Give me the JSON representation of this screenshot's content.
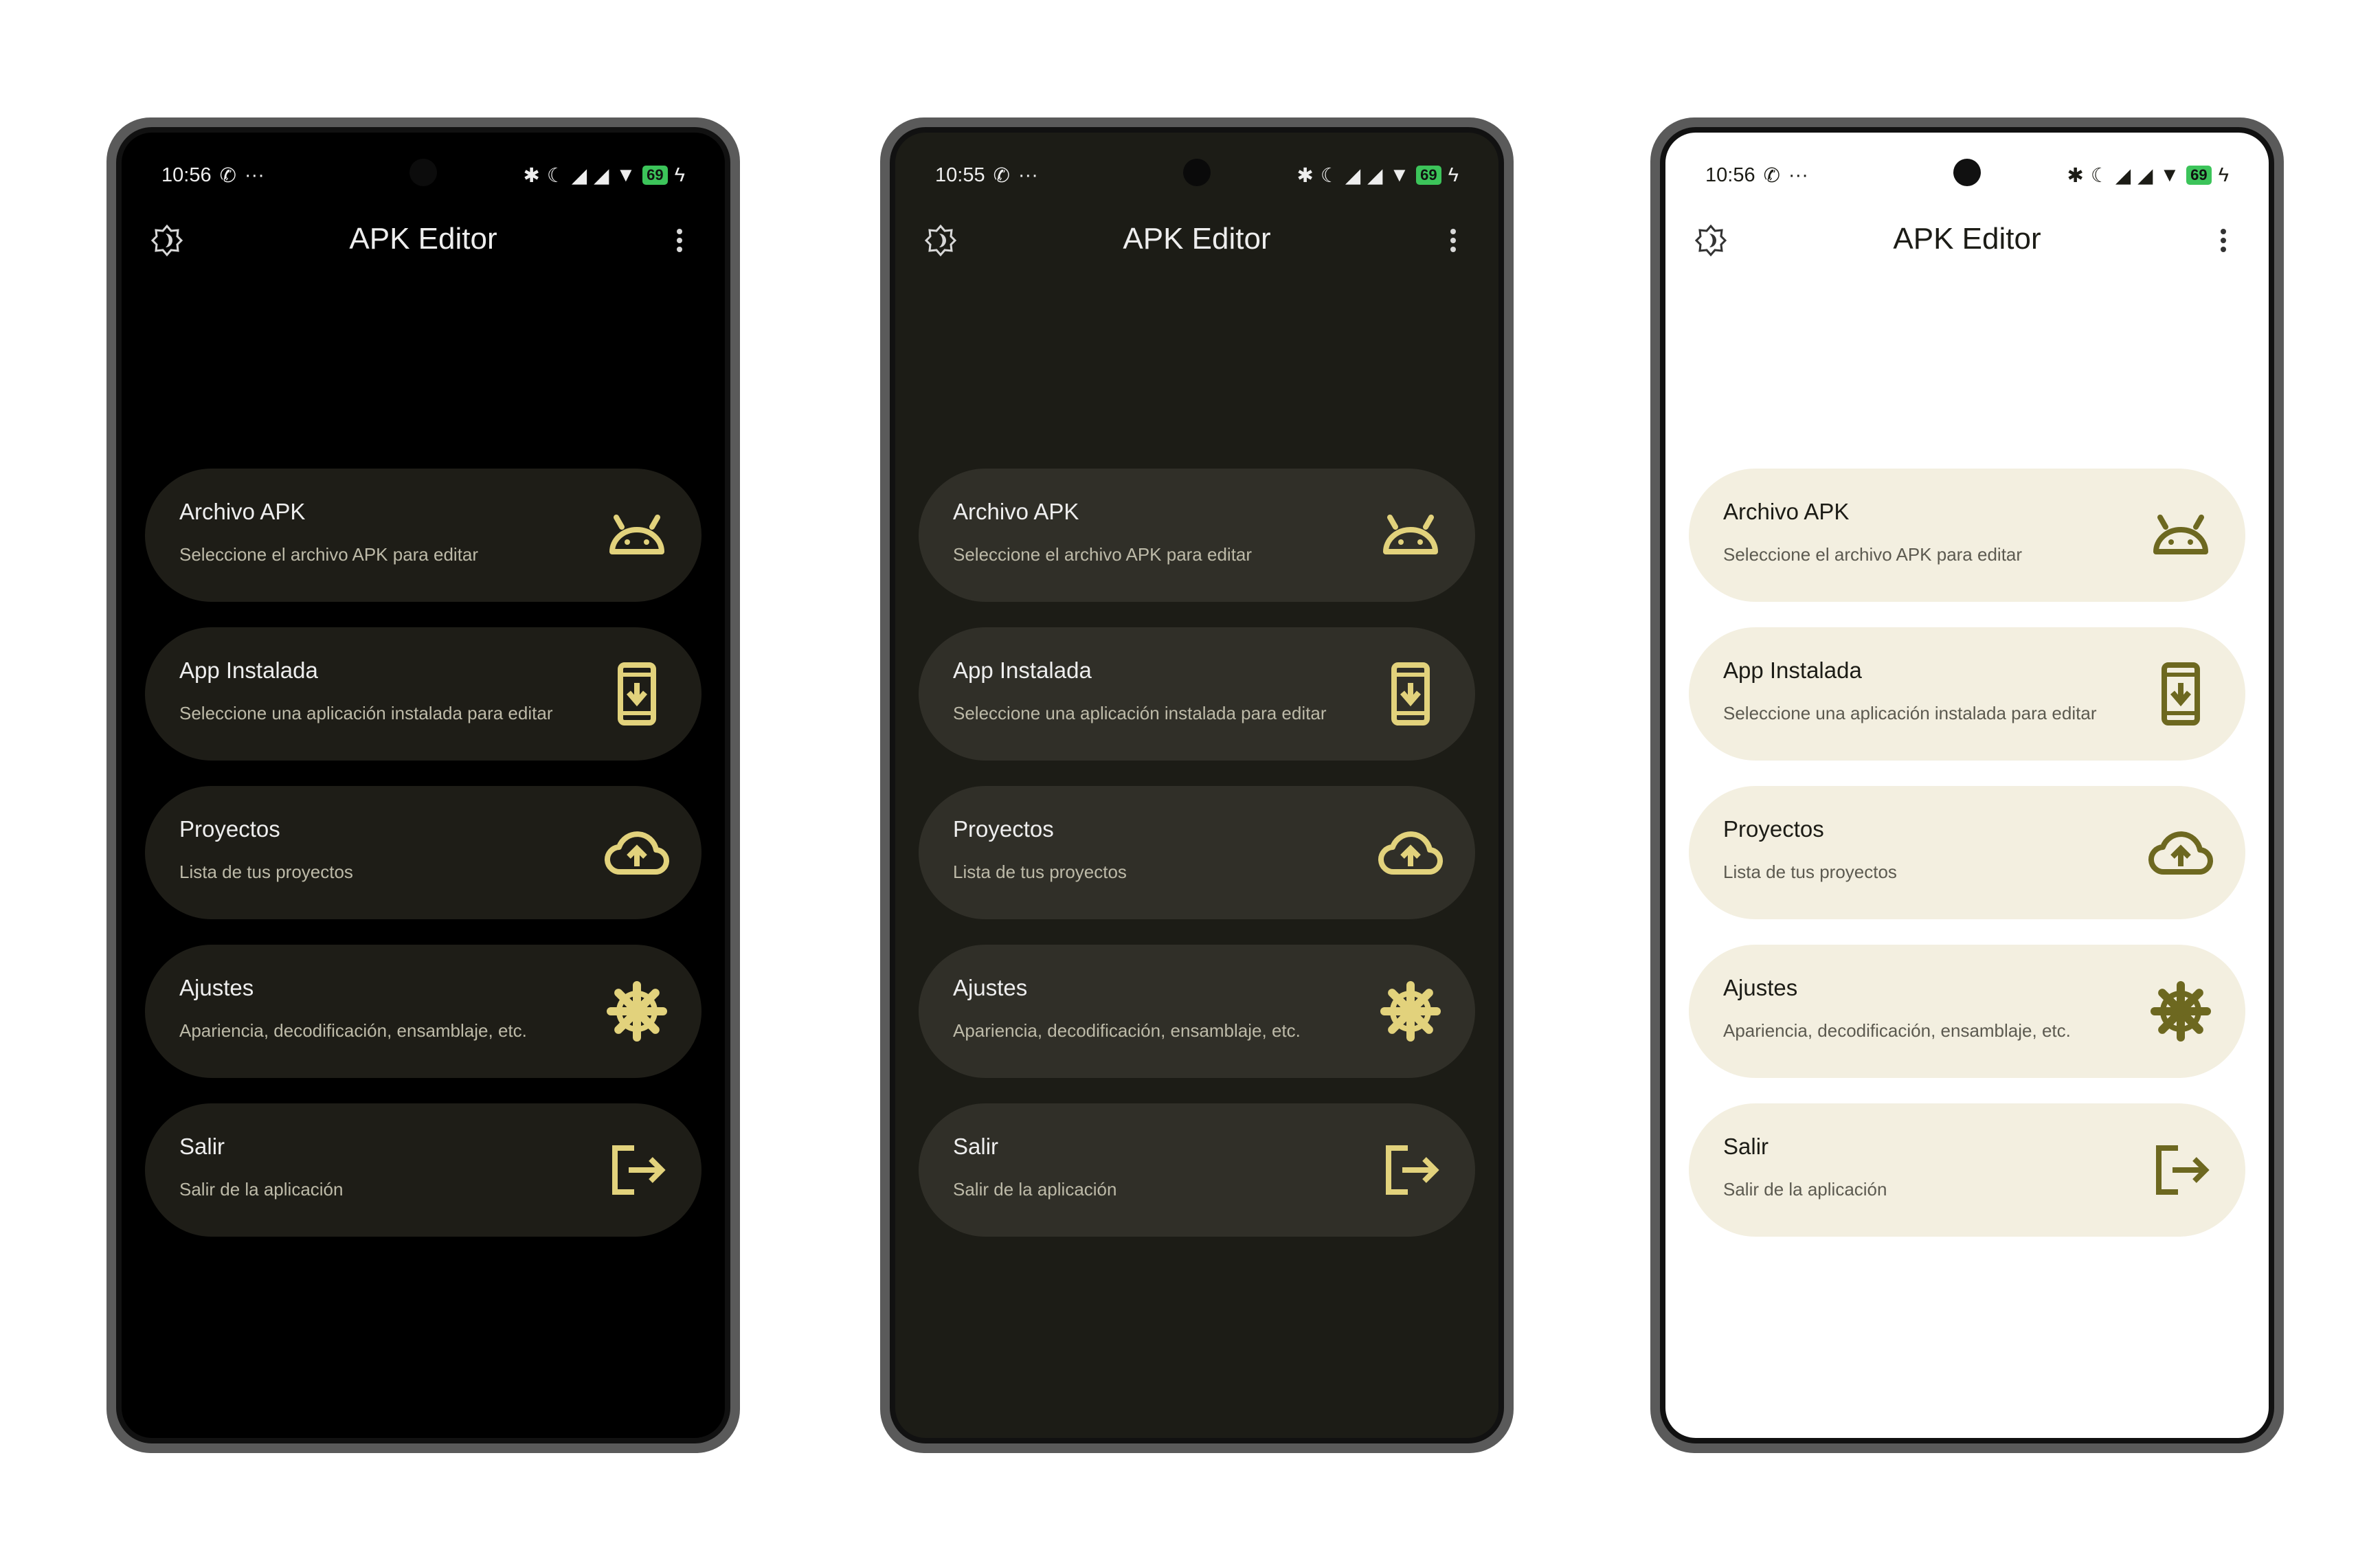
{
  "app": {
    "title": "APK Editor",
    "status_more": "···",
    "battery": "69",
    "items": [
      {
        "title": "Archivo APK",
        "subtitle": "Seleccione el archivo APK para editar",
        "icon": "android-icon"
      },
      {
        "title": "App Instalada",
        "subtitle": "Seleccione una aplicación instalada para editar",
        "icon": "phone-download-icon"
      },
      {
        "title": "Proyectos",
        "subtitle": "Lista de tus proyectos",
        "icon": "cloud-upload-icon"
      },
      {
        "title": "Ajustes",
        "subtitle": "Apariencia, decodificación, ensamblaje, etc.",
        "icon": "gear-icon"
      },
      {
        "title": "Salir",
        "subtitle": "Salir de la aplicación",
        "icon": "exit-icon"
      }
    ]
  },
  "phones": [
    {
      "theme": "amoled-black",
      "time": "10:56",
      "colors": {
        "bg": "#000000",
        "card": "#1e1d17",
        "text": "#eeeeee",
        "sub": "#bdbaa8",
        "accent": "#e2d27c",
        "icons": "#d8d8d8"
      }
    },
    {
      "theme": "dark",
      "time": "10:55",
      "colors": {
        "bg": "#1c1c16",
        "card": "#302f28",
        "text": "#eeeeee",
        "sub": "#bdbaa8",
        "accent": "#e2d27c",
        "icons": "#d8d8d8"
      }
    },
    {
      "theme": "light",
      "time": "10:56",
      "colors": {
        "bg": "#ffffff",
        "card": "#f3efe0",
        "text": "#1c1c16",
        "sub": "#5c5a50",
        "accent": "#6d6820",
        "icons": "#333333"
      }
    }
  ]
}
